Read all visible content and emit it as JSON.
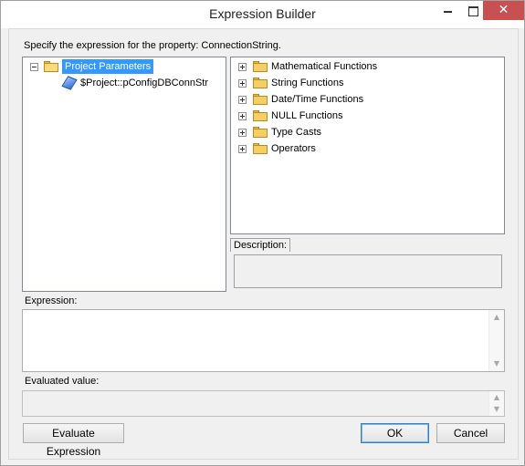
{
  "window": {
    "title": "Expression Builder",
    "close_glyph": "✕"
  },
  "prompt": "Specify the expression for the property: ConnectionString.",
  "variables_tree": {
    "root": {
      "label": "Project Parameters",
      "icon": "open-folder-icon",
      "expanded": true,
      "selected": true
    },
    "children": [
      {
        "label": "$Project::pConfigDBConnStr",
        "icon": "parameter-icon"
      }
    ]
  },
  "functions_tree": {
    "items": [
      {
        "label": "Mathematical Functions"
      },
      {
        "label": "String Functions"
      },
      {
        "label": "Date/Time Functions"
      },
      {
        "label": "NULL Functions"
      },
      {
        "label": "Type Casts"
      },
      {
        "label": "Operators"
      }
    ]
  },
  "description": {
    "label": "Description:",
    "value": ""
  },
  "expression": {
    "label": "Expression:",
    "value": ""
  },
  "evaluated": {
    "label": "Evaluated value:",
    "value": ""
  },
  "buttons": {
    "evaluate": "Evaluate Expression",
    "ok": "OK",
    "cancel": "Cancel"
  },
  "colors": {
    "selection": "#3399ff",
    "close_button": "#c75050",
    "dialog_bg": "#f0f0f0"
  }
}
